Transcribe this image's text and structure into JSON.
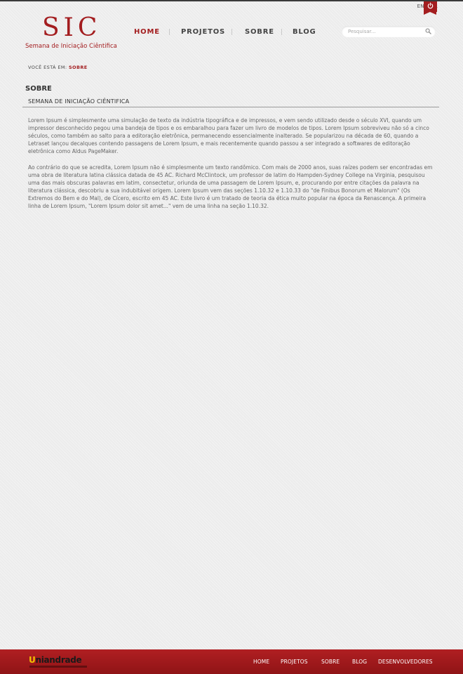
{
  "header": {
    "login_label": "ENTRAR",
    "logo_title": "SIC",
    "logo_subtitle": "Semana de Iniciação Ciêntifica",
    "power_icon": "power-icon",
    "accent_color": "#a31d1f"
  },
  "nav": {
    "items": [
      {
        "label": "HOME",
        "active": true
      },
      {
        "label": "PROJETOS",
        "active": false
      },
      {
        "label": "SOBRE",
        "active": false
      },
      {
        "label": "BLOG",
        "active": false
      }
    ]
  },
  "search": {
    "placeholder": "Pesquisar...",
    "value": "",
    "icon": "search-icon"
  },
  "breadcrumb": {
    "prefix": "VOCÊ ESTÁ EM:",
    "current": "SOBRE"
  },
  "main": {
    "page_title": "SOBRE",
    "section_title": "SEMANA DE INICIAÇÃO CIÊNTIFICA",
    "paragraphs": [
      "Lorem Ipsum é simplesmente uma simulação de texto da indústria tipográfica e de impressos, e vem sendo utilizado desde o século XVI, quando um impressor desconhecido pegou uma bandeja de tipos e os embaralhou para fazer um livro de modelos de tipos. Lorem Ipsum sobreviveu não só a cinco séculos, como também ao salto para a editoração eletrônica, permanecendo essencialmente inalterado. Se popularizou na década de 60, quando a Letraset lançou decalques contendo passagens de Lorem Ipsum, e mais recentemente quando passou a ser integrado a softwares de editoração eletrônica como Aldus PageMaker.",
      "Ao contrário do que se acredita, Lorem Ipsum não é simplesmente um texto randômico. Com mais de 2000 anos, suas raízes podem ser encontradas em uma obra de literatura latina clássica datada de 45 AC. Richard McClintock, um professor de latim do Hampden-Sydney College na Virginia, pesquisou uma das mais obscuras palavras em latim, consectetur, oriunda de uma passagem de Lorem Ipsum, e, procurando por entre citações da palavra na literatura clássica, descobriu a sua indubitável origem. Lorem Ipsum vem das seções 1.10.32 e 1.10.33 do \"de Finibus Bonorum et Malorum\" (Os Extremos do Bem e do Mal), de Cícero, escrito em 45 AC. Este livro é um tratado de teoria da ética muito popular na época da Renascença. A primeira linha de Lorem Ipsum, \"Lorem Ipsum dolor sit amet...\" vem de uma linha na seção 1.10.32."
    ]
  },
  "footer": {
    "logo_initial": "U",
    "logo_rest": "niandrade",
    "links": [
      "HOME",
      "PROJETOS",
      "SOBRE",
      "BLOG",
      "DESENVOLVEDORES"
    ]
  }
}
